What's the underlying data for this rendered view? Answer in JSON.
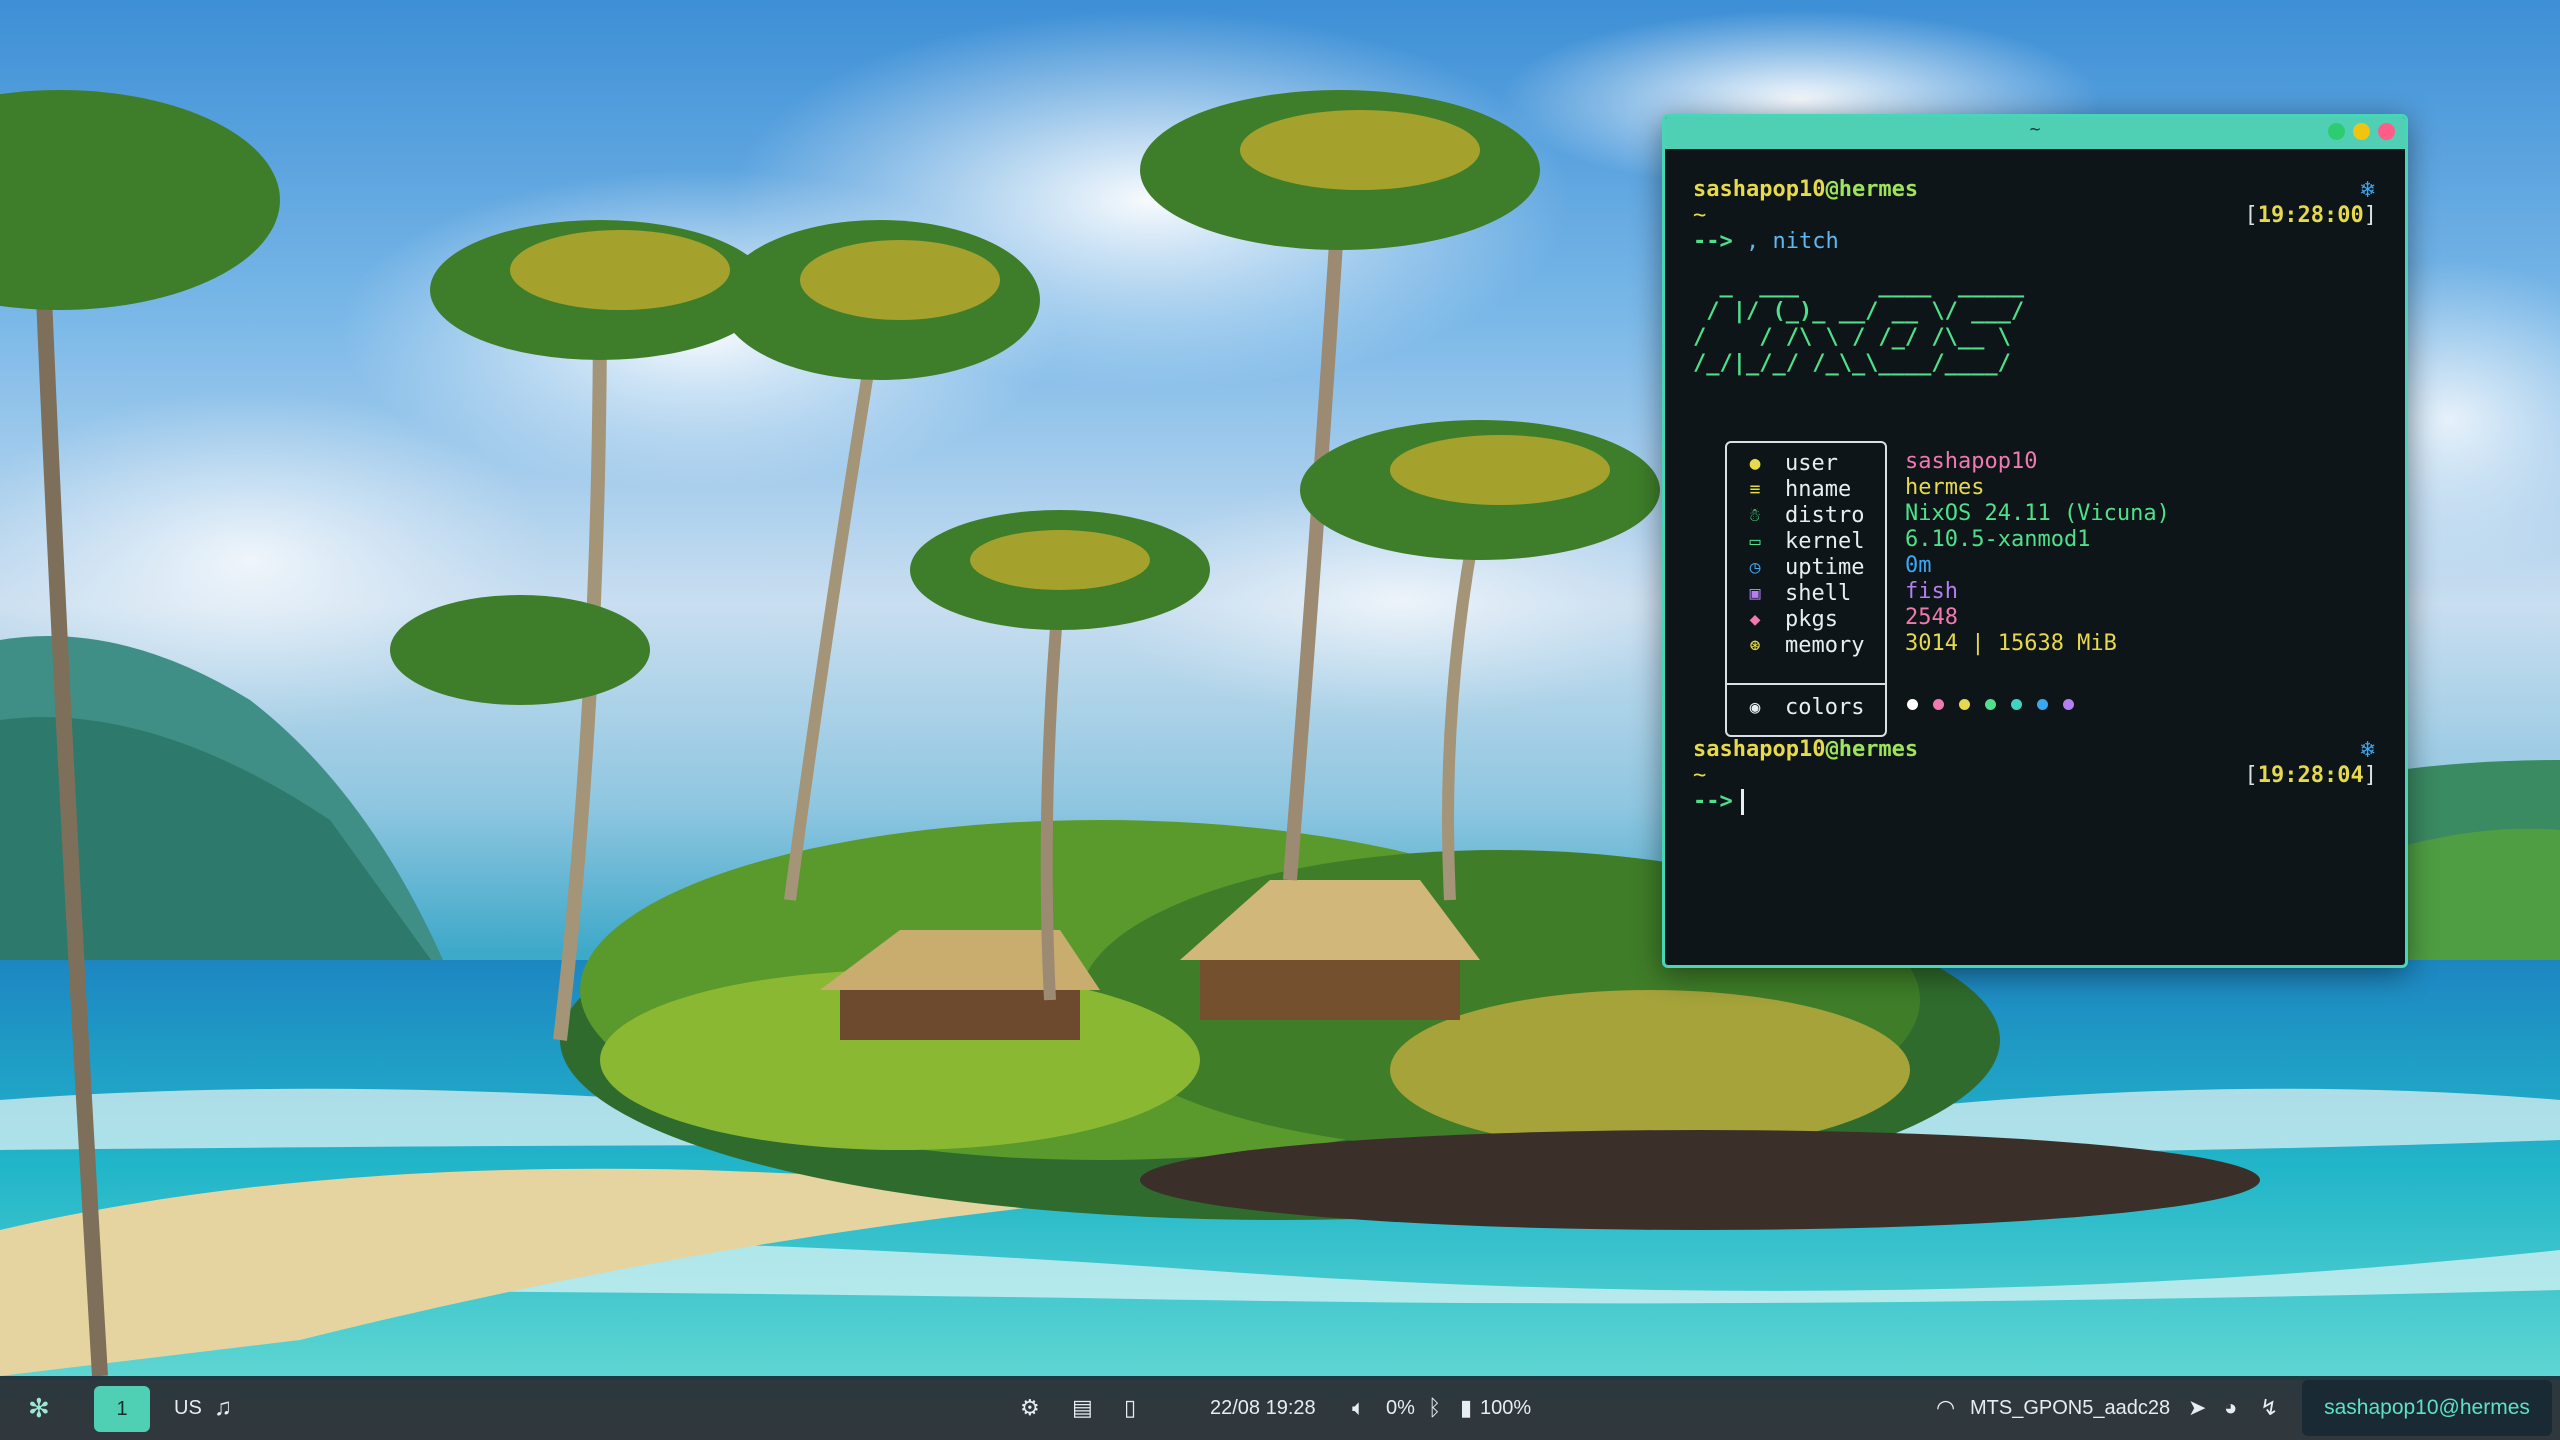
{
  "terminal": {
    "title": "~",
    "session1": {
      "user": "sashapop10",
      "host": "@hermes",
      "cwd": "~",
      "time_open": "[",
      "time": "19:28:00",
      "time_close": "]",
      "prompt": "-->",
      "command": ", nitch"
    },
    "ascii_logo": "  _  ___      ____  _____\n / |/ (_)_ __/ __ \\/ ___/\n/    / /\\ \\ / /_/ /\\__ \\ \n/_/|_/_/ /_\\_\\____/____/",
    "info": [
      {
        "icon": "user-icon",
        "label": "user",
        "value": "sashapop10",
        "color": "#f07ab0"
      },
      {
        "icon": "hostname-icon",
        "label": "hname",
        "value": "hermes",
        "color": "#e6d94c"
      },
      {
        "icon": "distro-icon",
        "label": "distro",
        "value": "NixOS 24.11 (Vicuna)",
        "color": "#4ee08a"
      },
      {
        "icon": "kernel-icon",
        "label": "kernel",
        "value": "6.10.5-xanmod1",
        "color": "#4ee08a"
      },
      {
        "icon": "uptime-icon",
        "label": "uptime",
        "value": "0m",
        "color": "#3aa7f2"
      },
      {
        "icon": "shell-icon",
        "label": "shell",
        "value": "fish",
        "color": "#b57ef2"
      },
      {
        "icon": "pkgs-icon",
        "label": "pkgs",
        "value": "2548",
        "color": "#f07ab0"
      },
      {
        "icon": "memory-icon",
        "label": "memory",
        "value": "3014 | 15638 MiB",
        "color": "#e6d94c"
      }
    ],
    "colors_label": "colors",
    "palette": [
      "#ffffff",
      "#f07ab0",
      "#e6d94c",
      "#4ee08a",
      "#3ed4c0",
      "#3aa7f2",
      "#b57ef2"
    ],
    "session2": {
      "user": "sashapop10",
      "host": "@hermes",
      "cwd": "~",
      "time_open": "[",
      "time": "19:28:04",
      "time_close": "]",
      "prompt": "-->"
    },
    "window_buttons": [
      "#2ecc71",
      "#f1c40f",
      "#ff5c8a"
    ]
  },
  "bar": {
    "workspace": "1",
    "keyboard_layout": "US",
    "datetime": "22/08 19:28",
    "volume": "0%",
    "battery": "100%",
    "wifi": "MTS_GPON5_aadc28",
    "user": "sashapop10@hermes"
  }
}
